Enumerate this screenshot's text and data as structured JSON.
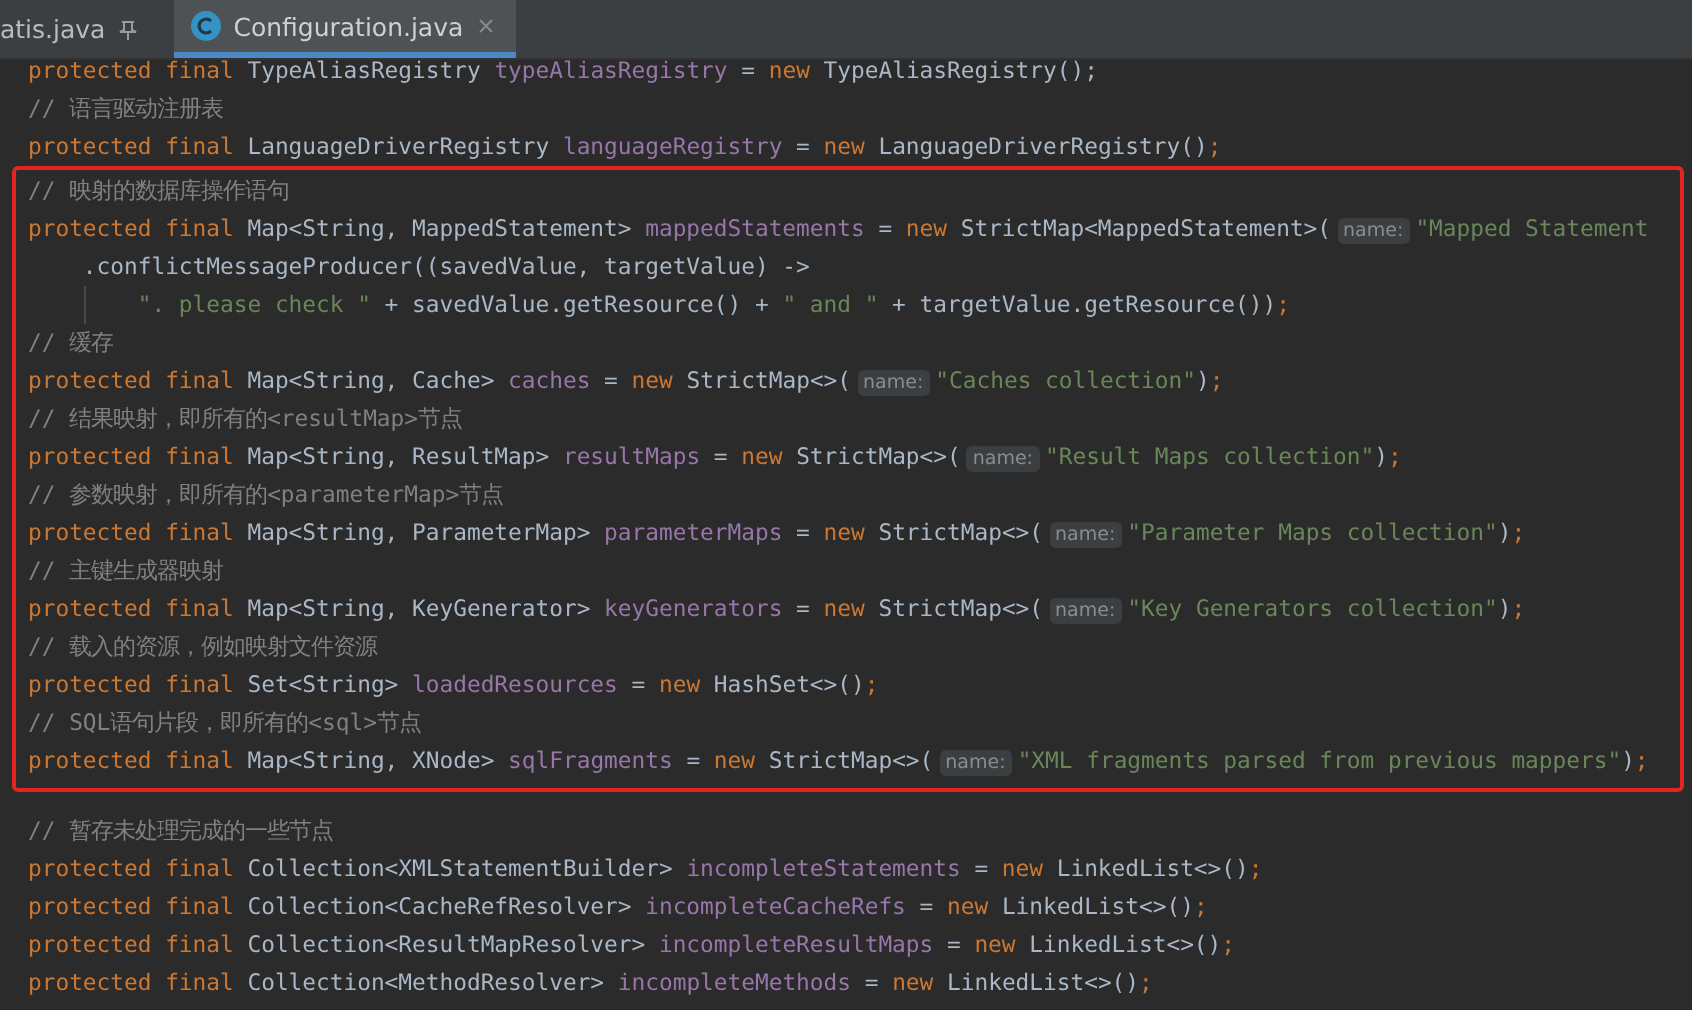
{
  "tabs": [
    {
      "label": "atis.java",
      "selected": false,
      "pinned": true,
      "icon": false
    },
    {
      "label": "Configuration.java",
      "selected": true,
      "pinned": false,
      "icon": true
    }
  ],
  "code": {
    "blocks": [
      {
        "boxed": false,
        "lines": [
          {
            "guide": false,
            "tokens": [
              {
                "kind": "kw",
                "text": "protected final "
              },
              {
                "kind": "plain",
                "text": "TypeAliasRegistry "
              },
              {
                "kind": "field",
                "text": "typeAliasRegistry"
              },
              {
                "kind": "plain",
                "text": " = "
              },
              {
                "kind": "kw",
                "text": "new "
              },
              {
                "kind": "plain",
                "text": "TypeAliasRegistry();"
              }
            ]
          },
          {
            "guide": false,
            "tokens": [
              {
                "kind": "comment",
                "text": "// 语言驱动注册表"
              }
            ]
          },
          {
            "guide": false,
            "tokens": [
              {
                "kind": "kw",
                "text": "protected final "
              },
              {
                "kind": "plain",
                "text": "LanguageDriverRegistry "
              },
              {
                "kind": "field",
                "text": "languageRegistry"
              },
              {
                "kind": "plain",
                "text": " = "
              },
              {
                "kind": "kw",
                "text": "new "
              },
              {
                "kind": "plain",
                "text": "LanguageDriverRegistry()"
              },
              {
                "kind": "kw",
                "text": ";"
              }
            ]
          }
        ]
      },
      {
        "boxed": true,
        "lines": [
          {
            "guide": false,
            "tokens": [
              {
                "kind": "comment",
                "text": "// 映射的数据库操作语句"
              }
            ]
          },
          {
            "guide": false,
            "tokens": [
              {
                "kind": "kw",
                "text": "protected final "
              },
              {
                "kind": "plain",
                "text": "Map<String, MappedStatement> "
              },
              {
                "kind": "field",
                "text": "mappedStatements"
              },
              {
                "kind": "plain",
                "text": " = "
              },
              {
                "kind": "kw",
                "text": "new "
              },
              {
                "kind": "plain",
                "text": "StrictMap<MappedStatement>("
              },
              {
                "kind": "hint",
                "text": "name:"
              },
              {
                "kind": "str",
                "text": "\"Mapped Statement"
              }
            ]
          },
          {
            "guide": false,
            "tokens": [
              {
                "kind": "plain",
                "text": "    .conflictMessageProducer((savedValue, targetValue) ->"
              }
            ]
          },
          {
            "guide": true,
            "tokens": [
              {
                "kind": "str",
                "text": "        \". please check \""
              },
              {
                "kind": "plain",
                "text": " + savedValue.getResource() + "
              },
              {
                "kind": "str",
                "text": "\" and \""
              },
              {
                "kind": "plain",
                "text": " + targetValue.getResource())"
              },
              {
                "kind": "kw",
                "text": ";"
              }
            ]
          },
          {
            "guide": false,
            "tokens": [
              {
                "kind": "comment",
                "text": "// 缓存"
              }
            ]
          },
          {
            "guide": false,
            "tokens": [
              {
                "kind": "kw",
                "text": "protected final "
              },
              {
                "kind": "plain",
                "text": "Map<String, Cache> "
              },
              {
                "kind": "field",
                "text": "caches"
              },
              {
                "kind": "plain",
                "text": " = "
              },
              {
                "kind": "kw",
                "text": "new "
              },
              {
                "kind": "plain",
                "text": "StrictMap<>("
              },
              {
                "kind": "hint",
                "text": "name:"
              },
              {
                "kind": "str",
                "text": "\"Caches collection\""
              },
              {
                "kind": "plain",
                "text": ")"
              },
              {
                "kind": "kw",
                "text": ";"
              }
            ]
          },
          {
            "guide": false,
            "tokens": [
              {
                "kind": "comment",
                "text": "// 结果映射，即所有的<resultMap>节点"
              }
            ]
          },
          {
            "guide": false,
            "tokens": [
              {
                "kind": "kw",
                "text": "protected final "
              },
              {
                "kind": "plain",
                "text": "Map<String, ResultMap> "
              },
              {
                "kind": "field",
                "text": "resultMaps"
              },
              {
                "kind": "plain",
                "text": " = "
              },
              {
                "kind": "kw",
                "text": "new "
              },
              {
                "kind": "plain",
                "text": "StrictMap<>("
              },
              {
                "kind": "hint",
                "text": "name:"
              },
              {
                "kind": "str",
                "text": "\"Result Maps collection\""
              },
              {
                "kind": "plain",
                "text": ")"
              },
              {
                "kind": "kw",
                "text": ";"
              }
            ]
          },
          {
            "guide": false,
            "tokens": [
              {
                "kind": "comment",
                "text": "// 参数映射，即所有的<parameterMap>节点"
              }
            ]
          },
          {
            "guide": false,
            "tokens": [
              {
                "kind": "kw",
                "text": "protected final "
              },
              {
                "kind": "plain",
                "text": "Map<String, ParameterMap> "
              },
              {
                "kind": "field",
                "text": "parameterMaps"
              },
              {
                "kind": "plain",
                "text": " = "
              },
              {
                "kind": "kw",
                "text": "new "
              },
              {
                "kind": "plain",
                "text": "StrictMap<>("
              },
              {
                "kind": "hint",
                "text": "name:"
              },
              {
                "kind": "str",
                "text": "\"Parameter Maps collection\""
              },
              {
                "kind": "plain",
                "text": ")"
              },
              {
                "kind": "kw",
                "text": ";"
              }
            ]
          },
          {
            "guide": false,
            "tokens": [
              {
                "kind": "comment",
                "text": "// 主键生成器映射"
              }
            ]
          },
          {
            "guide": false,
            "tokens": [
              {
                "kind": "kw",
                "text": "protected final "
              },
              {
                "kind": "plain",
                "text": "Map<String, KeyGenerator> "
              },
              {
                "kind": "field",
                "text": "keyGenerators"
              },
              {
                "kind": "plain",
                "text": " = "
              },
              {
                "kind": "kw",
                "text": "new "
              },
              {
                "kind": "plain",
                "text": "StrictMap<>("
              },
              {
                "kind": "hint",
                "text": "name:"
              },
              {
                "kind": "str",
                "text": "\"Key Generators collection\""
              },
              {
                "kind": "plain",
                "text": ")"
              },
              {
                "kind": "kw",
                "text": ";"
              }
            ]
          },
          {
            "guide": false,
            "tokens": [
              {
                "kind": "comment",
                "text": "// 载入的资源，例如映射文件资源"
              }
            ]
          },
          {
            "guide": false,
            "tokens": [
              {
                "kind": "kw",
                "text": "protected final "
              },
              {
                "kind": "plain",
                "text": "Set<String> "
              },
              {
                "kind": "field",
                "text": "loadedResources"
              },
              {
                "kind": "plain",
                "text": " = "
              },
              {
                "kind": "kw",
                "text": "new "
              },
              {
                "kind": "plain",
                "text": "HashSet<>()"
              },
              {
                "kind": "kw",
                "text": ";"
              }
            ]
          },
          {
            "guide": false,
            "tokens": [
              {
                "kind": "comment",
                "text": "// SQL语句片段，即所有的<sql>节点"
              }
            ]
          },
          {
            "guide": false,
            "tokens": [
              {
                "kind": "kw",
                "text": "protected final "
              },
              {
                "kind": "plain",
                "text": "Map<String, XNode> "
              },
              {
                "kind": "field",
                "text": "sqlFragments"
              },
              {
                "kind": "plain",
                "text": " = "
              },
              {
                "kind": "kw",
                "text": "new "
              },
              {
                "kind": "plain",
                "text": "StrictMap<>("
              },
              {
                "kind": "hint",
                "text": "name:"
              },
              {
                "kind": "str",
                "text": "\"XML fragments parsed from previous mappers\""
              },
              {
                "kind": "plain",
                "text": ")"
              },
              {
                "kind": "kw",
                "text": ";"
              }
            ]
          }
        ]
      },
      {
        "boxed": false,
        "lines": [
          {
            "guide": false,
            "tokens": [
              {
                "kind": "comment",
                "text": "// 暂存未处理完成的一些节点"
              }
            ]
          },
          {
            "guide": false,
            "tokens": [
              {
                "kind": "kw",
                "text": "protected final "
              },
              {
                "kind": "plain",
                "text": "Collection<XMLStatementBuilder> "
              },
              {
                "kind": "field",
                "text": "incompleteStatements"
              },
              {
                "kind": "plain",
                "text": " = "
              },
              {
                "kind": "kw",
                "text": "new "
              },
              {
                "kind": "plain",
                "text": "LinkedList<>()"
              },
              {
                "kind": "kw",
                "text": ";"
              }
            ]
          },
          {
            "guide": false,
            "tokens": [
              {
                "kind": "kw",
                "text": "protected final "
              },
              {
                "kind": "plain",
                "text": "Collection<CacheRefResolver> "
              },
              {
                "kind": "field",
                "text": "incompleteCacheRefs"
              },
              {
                "kind": "plain",
                "text": " = "
              },
              {
                "kind": "kw",
                "text": "new "
              },
              {
                "kind": "plain",
                "text": "LinkedList<>()"
              },
              {
                "kind": "kw",
                "text": ";"
              }
            ]
          },
          {
            "guide": false,
            "tokens": [
              {
                "kind": "kw",
                "text": "protected final "
              },
              {
                "kind": "plain",
                "text": "Collection<ResultMapResolver> "
              },
              {
                "kind": "field",
                "text": "incompleteResultMaps"
              },
              {
                "kind": "plain",
                "text": " = "
              },
              {
                "kind": "kw",
                "text": "new "
              },
              {
                "kind": "plain",
                "text": "LinkedList<>()"
              },
              {
                "kind": "kw",
                "text": ";"
              }
            ]
          },
          {
            "guide": false,
            "tokens": [
              {
                "kind": "kw",
                "text": "protected final "
              },
              {
                "kind": "plain",
                "text": "Collection<MethodResolver> "
              },
              {
                "kind": "field",
                "text": "incompleteMethods"
              },
              {
                "kind": "plain",
                "text": " = "
              },
              {
                "kind": "kw",
                "text": "new "
              },
              {
                "kind": "plain",
                "text": "LinkedList<>()"
              },
              {
                "kind": "kw",
                "text": ";"
              }
            ]
          }
        ]
      }
    ]
  }
}
